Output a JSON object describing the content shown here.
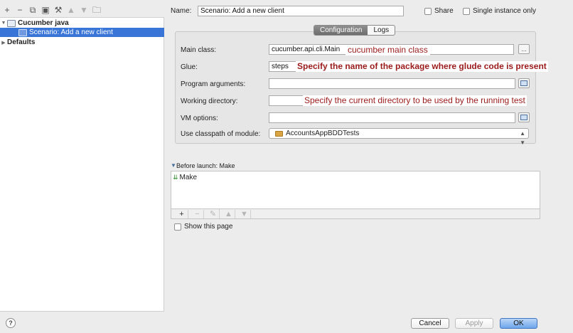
{
  "tree": {
    "toolbar_icons": [
      "add-icon",
      "remove-icon",
      "copy-icon",
      "save-icon",
      "edit-defaults-icon",
      "move-up-icon",
      "move-down-icon",
      "folder-icon"
    ],
    "items": [
      {
        "label": "Cucumber java"
      },
      {
        "label": "Scenario: Add a new client"
      },
      {
        "label": "Defaults"
      }
    ]
  },
  "header": {
    "name_label": "Name:",
    "name_value": "Scenario: Add a new client",
    "share_label": "Share",
    "single_instance_label": "Single instance only"
  },
  "tabs": [
    {
      "label": "Configuration",
      "active": true
    },
    {
      "label": "Logs",
      "active": false
    }
  ],
  "form": {
    "main_class_label": "Main class:",
    "main_class_value": "cucumber.api.cli.Main",
    "main_class_note": "cucumber main class",
    "glue_label": "Glue:",
    "glue_value": "steps",
    "glue_note": "Specify the name of the package where glude code is present",
    "program_args_label": "Program arguments:",
    "program_args_value": "",
    "working_dir_label": "Working directory:",
    "working_dir_value": "",
    "working_dir_note": "Specify the current directory to be used by the running test",
    "vm_options_label": "VM options:",
    "vm_options_value": "",
    "classpath_label": "Use classpath of module:",
    "classpath_value": "AccountsAppBDDTests",
    "browse_label": "..."
  },
  "before_launch": {
    "title": "Before launch: Make",
    "items": [
      {
        "label": "Make"
      }
    ],
    "show_page_label": "Show this page"
  },
  "buttons": {
    "help": "?",
    "cancel": "Cancel",
    "apply": "Apply",
    "ok": "OK"
  },
  "colors": {
    "selection": "#3875d7",
    "annotation": "#9b1b1b",
    "primary_button": "#6ea6ec"
  }
}
